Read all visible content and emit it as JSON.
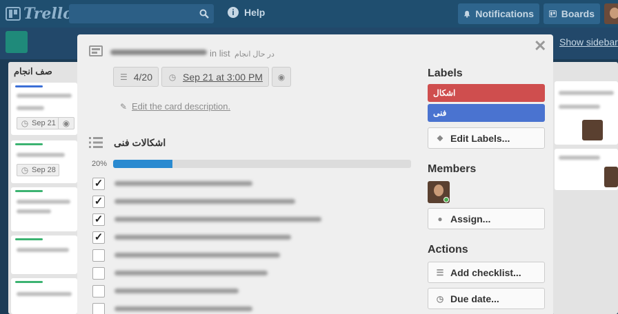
{
  "header": {
    "logo": "Trello",
    "help": "Help",
    "notifications": "Notifications",
    "boards": "Boards"
  },
  "board": {
    "show_sidebar": "Show sidebar",
    "left_list_title": "صف انجام",
    "left_cards": [
      {
        "due": "Sep 21"
      },
      {
        "due": "Sep 28"
      }
    ]
  },
  "card": {
    "in_list_label": "in list",
    "list_name": "در حال انجام",
    "checklist_badge": "4/20",
    "due_badge": "Sep 21 at 3:00 PM",
    "edit_description": "Edit the card description.",
    "checklist_title": "اشکالات فنی",
    "progress_text": "20%",
    "progress_fraction": 0.2,
    "items": [
      {
        "checked": true
      },
      {
        "checked": true
      },
      {
        "checked": true
      },
      {
        "checked": true
      },
      {
        "checked": false
      },
      {
        "checked": false
      },
      {
        "checked": false
      },
      {
        "checked": false
      }
    ]
  },
  "sidebar": {
    "labels_title": "Labels",
    "labels": [
      {
        "text": "اشکال",
        "color": "#cf4e4e"
      },
      {
        "text": "فنی",
        "color": "#4a73d0"
      }
    ],
    "edit_labels": "Edit Labels...",
    "members_title": "Members",
    "assign": "Assign...",
    "actions_title": "Actions",
    "add_checklist": "Add checklist...",
    "due_date": "Due date..."
  }
}
